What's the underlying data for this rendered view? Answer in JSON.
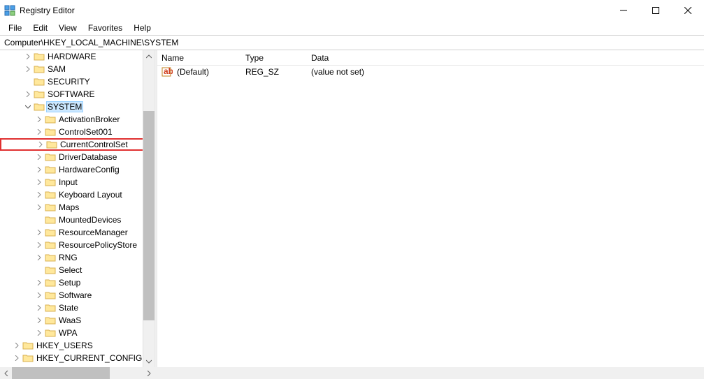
{
  "window": {
    "title": "Registry Editor"
  },
  "menu": {
    "file": "File",
    "edit": "Edit",
    "view": "View",
    "favorites": "Favorites",
    "help": "Help"
  },
  "address": "Computer\\HKEY_LOCAL_MACHINE\\SYSTEM",
  "tree": {
    "hardware": "HARDWARE",
    "sam": "SAM",
    "security": "SECURITY",
    "software": "SOFTWARE",
    "system": "SYSTEM",
    "activationbroker": "ActivationBroker",
    "controlset001": "ControlSet001",
    "currentcontrolset": "CurrentControlSet",
    "driverdatabase": "DriverDatabase",
    "hardwareconfig": "HardwareConfig",
    "input": "Input",
    "keyboardlayout": "Keyboard Layout",
    "maps": "Maps",
    "mounteddevices": "MountedDevices",
    "resourcemanager": "ResourceManager",
    "resourcepolicystore": "ResourcePolicyStore",
    "rng": "RNG",
    "select": "Select",
    "setup": "Setup",
    "software2": "Software",
    "state": "State",
    "waas": "WaaS",
    "wpa": "WPA",
    "hkey_users": "HKEY_USERS",
    "hkey_current_config": "HKEY_CURRENT_CONFIG"
  },
  "list": {
    "col_name": "Name",
    "col_type": "Type",
    "col_data": "Data",
    "row0": {
      "name": "(Default)",
      "type": "REG_SZ",
      "data": "(value not set)"
    }
  }
}
